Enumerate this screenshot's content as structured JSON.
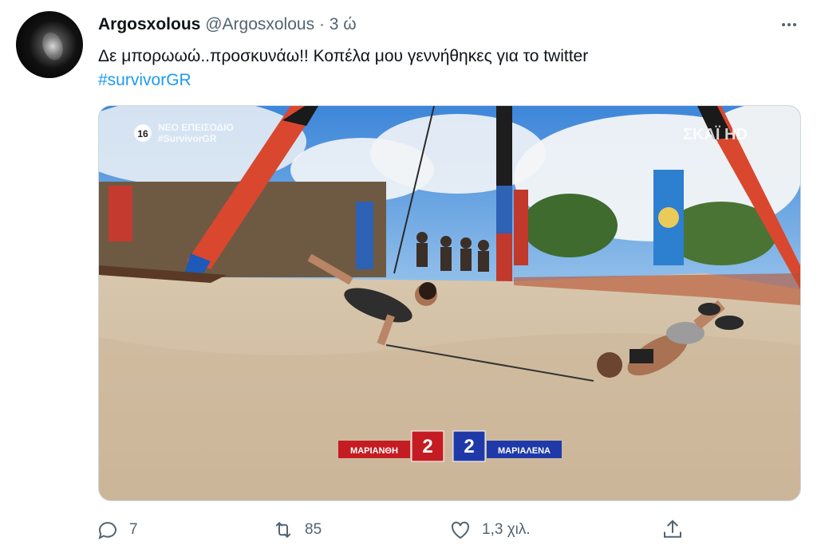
{
  "tweet": {
    "author_name": "Argosxolous",
    "author_handle": "@Argosxolous",
    "separator": "·",
    "time": "3 ώ",
    "text": "Δε μπορωωώ..προσκυνάω!! Κοπέλα μου γεννήθηκες για το twitter",
    "hashtag": "#survivorGR"
  },
  "media": {
    "overlay_badge": "16",
    "overlay_title": "ΝΕΟ ΕΠΕΙΣΟΔΙΟ",
    "overlay_tag": "#SurvivorGR",
    "channel": "ΣΚΑΪ HD",
    "score": {
      "left_name": "ΜΑΡΙΑΝΘΗ",
      "left_score": "2",
      "right_score": "2",
      "right_name": "ΜΑΡΙΑΛΕΝΑ"
    }
  },
  "actions": {
    "replies": "7",
    "retweets": "85",
    "likes": "1,3 χιλ."
  },
  "colors": {
    "link": "#1d9bf0",
    "secondary_text": "#536471",
    "score_red": "#c41c22",
    "score_blue": "#1f3aa8"
  },
  "icons": [
    "reply-icon",
    "retweet-icon",
    "like-icon",
    "share-icon",
    "more-icon"
  ]
}
